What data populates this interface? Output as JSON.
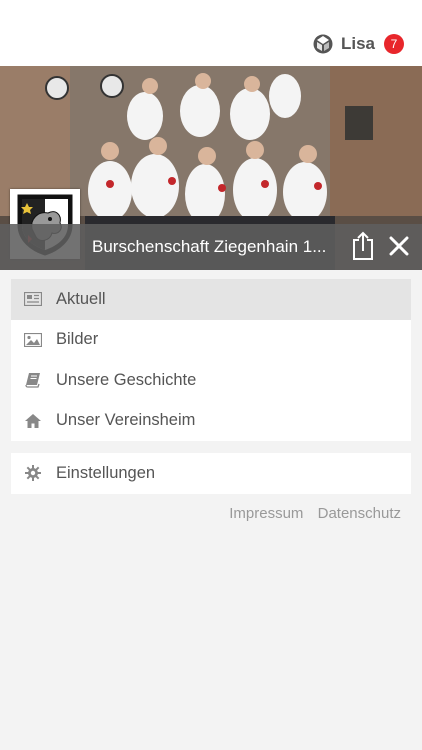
{
  "header": {
    "user_name": "Lisa",
    "notification_count": "7",
    "user_icon": "cube-logo-icon"
  },
  "group": {
    "title": "Burschenschaft Ziegenhain 1..."
  },
  "menu": {
    "items": [
      {
        "label": "Aktuell",
        "icon": "newspaper-icon",
        "active": true
      },
      {
        "label": "Bilder",
        "icon": "image-icon",
        "active": false
      },
      {
        "label": "Unsere Geschichte",
        "icon": "book-icon",
        "active": false
      },
      {
        "label": "Unser Vereinsheim",
        "icon": "home-icon",
        "active": false
      }
    ],
    "settings": {
      "label": "Einstellungen",
      "icon": "gear-icon"
    }
  },
  "footer": {
    "impressum": "Impressum",
    "datenschutz": "Datenschutz"
  },
  "colors": {
    "badge": "#e8262b",
    "active_item": "#e4e4e4",
    "title_bar": "#5f5f5f"
  }
}
